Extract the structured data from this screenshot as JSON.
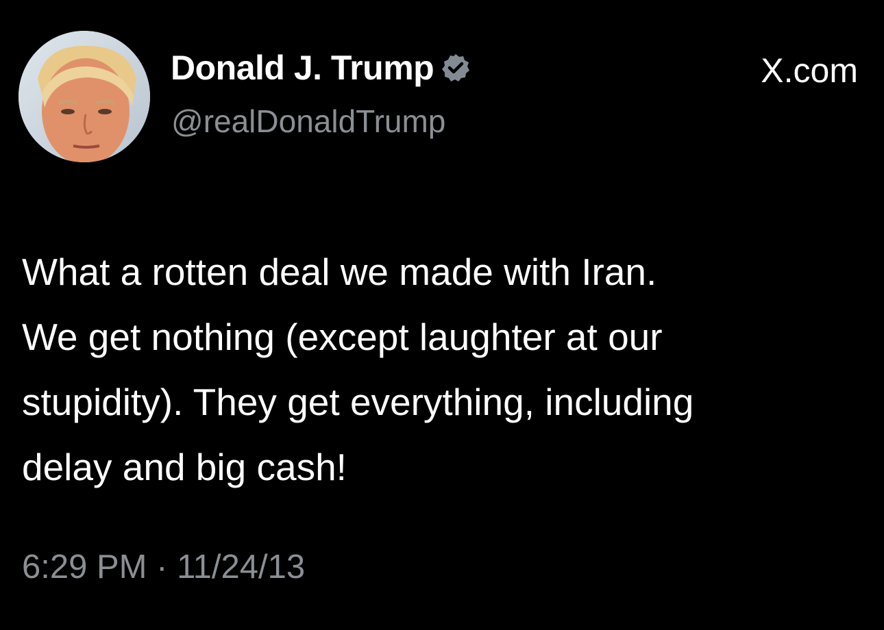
{
  "author": {
    "display_name": "Donald J. Trump",
    "handle": "@realDonaldTrump",
    "verified_icon": "verified-badge-icon",
    "avatar_icon": "profile-photo"
  },
  "site_label": "X.com",
  "tweet": {
    "lines": [
      "What a rotten deal we made with Iran.",
      "We get nothing (except laughter at our",
      "stupidity). They get everything, including",
      "delay and big cash!"
    ],
    "time": "6:29 PM",
    "separator": "·",
    "date": "11/24/13"
  },
  "colors": {
    "background": "#000000",
    "primary_text": "#ffffff",
    "secondary_text": "#8b8f94",
    "badge": "#828a93"
  }
}
